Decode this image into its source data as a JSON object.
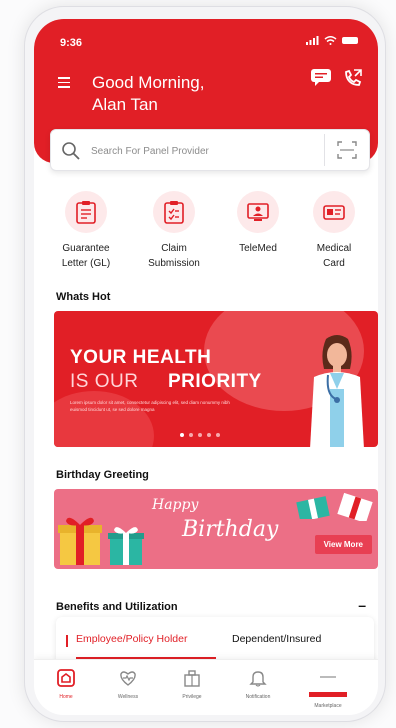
{
  "status_bar": {
    "time": "9:36"
  },
  "header": {
    "greeting_line1": "Good Morning,",
    "greeting_line2": "Alan Tan"
  },
  "search": {
    "placeholder": "Search For Panel Provider"
  },
  "quick_actions": [
    {
      "label_line1": "Guarantee",
      "label_line2": "Letter (GL)",
      "icon": "clipboard-icon"
    },
    {
      "label_line1": "Claim",
      "label_line2": "Submission",
      "icon": "claim-form-icon"
    },
    {
      "label_line1": "TeleMed",
      "label_line2": "",
      "icon": "telemed-icon"
    },
    {
      "label_line1": "Medical",
      "label_line2": "Card",
      "icon": "medical-card-icon"
    }
  ],
  "whats_hot": {
    "title": "Whats Hot",
    "banner": {
      "line1": "YOUR HEALTH",
      "line2a": "IS OUR",
      "line2b": "PRIORITY",
      "body": "Lorem ipsum dolor sit amet, consectetur adipiscing elit, sed diam nonummy nibh euismod tincidunt ut, se sed dolore magna"
    }
  },
  "birthday": {
    "title": "Birthday Greeting",
    "happy": "Happy",
    "birthday": "Birthday",
    "view_more": "View More"
  },
  "benefits": {
    "title": "Benefits and Utilization",
    "collapse_symbol": "–",
    "tabs": [
      "Employee/Policy Holder",
      "Dependent/Insured"
    ]
  },
  "bottom_nav": [
    {
      "label": "Home",
      "icon": "home-icon"
    },
    {
      "label": "Wellness",
      "icon": "wellness-icon"
    },
    {
      "label": "Privilege",
      "icon": "privilege-icon"
    },
    {
      "label": "Notification",
      "icon": "bell-icon"
    },
    {
      "label": "Marketplace",
      "icon": "marketplace-icon"
    }
  ],
  "colors": {
    "brand_red": "#e11f26",
    "pink_tint": "#fde9ea",
    "birthday_pink": "#ec6f86"
  }
}
